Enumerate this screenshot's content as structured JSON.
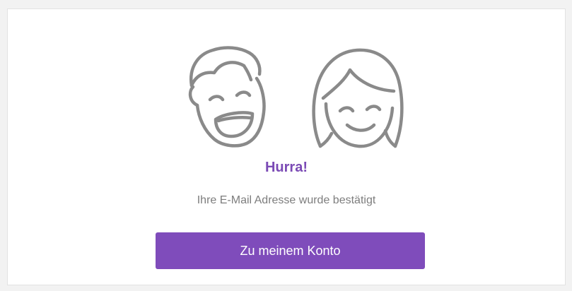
{
  "confirmation": {
    "title": "Hurra!",
    "message": "Ihre E-Mail Adresse wurde bestätigt",
    "button_label": "Zu meinem Konto"
  },
  "illustration": {
    "icon": "happy-couple-faces-illustration"
  },
  "colors": {
    "accent": "#7f4cbb",
    "title": "#7b4ab5",
    "text_muted": "#7d7d7d",
    "line_art": "#8a8a8a",
    "background": "#f2f2f2",
    "card": "#ffffff"
  }
}
